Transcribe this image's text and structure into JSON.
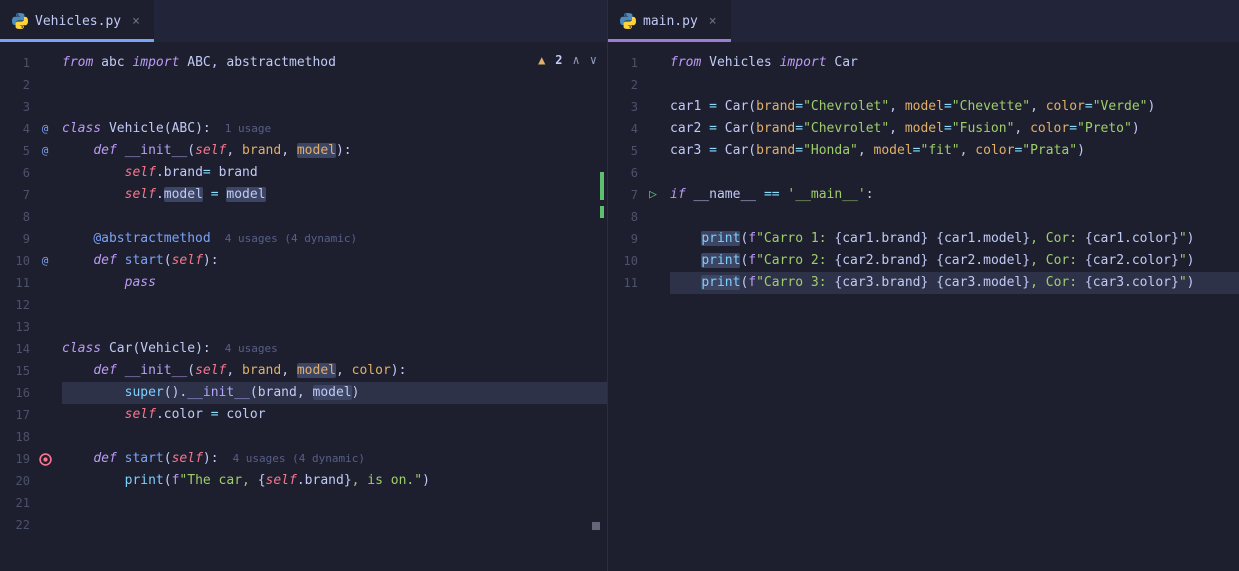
{
  "left": {
    "tab": {
      "label": "Vehicles.py"
    },
    "inspections": {
      "count": "2"
    },
    "lines": {
      "l1": {
        "num": "1"
      },
      "l2": {
        "num": "2"
      },
      "l3": {
        "num": "3"
      },
      "l4": {
        "num": "4",
        "usage": "1 usage"
      },
      "l5": {
        "num": "5"
      },
      "l6": {
        "num": "6"
      },
      "l7": {
        "num": "7"
      },
      "l8": {
        "num": "8"
      },
      "l9": {
        "num": "9",
        "usage": "4 usages (4 dynamic)"
      },
      "l10": {
        "num": "10"
      },
      "l11": {
        "num": "11"
      },
      "l12": {
        "num": "12"
      },
      "l13": {
        "num": "13"
      },
      "l14": {
        "num": "14",
        "usage": "4 usages"
      },
      "l15": {
        "num": "15"
      },
      "l16": {
        "num": "16"
      },
      "l17": {
        "num": "17"
      },
      "l18": {
        "num": "18"
      },
      "l19": {
        "num": "19",
        "usage": "4 usages (4 dynamic)"
      },
      "l20": {
        "num": "20"
      },
      "l21": {
        "num": "21"
      },
      "l22": {
        "num": "22"
      }
    },
    "code": {
      "l1_from": "from",
      "l1_abc": "abc",
      "l1_import": "import",
      "l1_ABC": "ABC",
      "l1_am": "abstractmethod",
      "l4_class": "class",
      "l4_Vehicle": "Vehicle",
      "l4_ABC": "ABC",
      "l5_def": "def",
      "l5_init": "__init__",
      "l5_self": "self",
      "l5_brand": "brand",
      "l5_model": "model",
      "l6_self": "self",
      "l6_brand1": "brand",
      "l6_brand2": "brand",
      "l7_self": "self",
      "l7_model1": "model",
      "l7_model2": "model",
      "l9_dec": "@abstractmethod",
      "l10_def": "def",
      "l10_start": "start",
      "l10_self": "self",
      "l11_pass": "pass",
      "l14_class": "class",
      "l14_Car": "Car",
      "l14_Vehicle": "Vehicle",
      "l15_def": "def",
      "l15_init": "__init__",
      "l15_self": "self",
      "l15_brand": "brand",
      "l15_model": "model",
      "l15_color": "color",
      "l16_super": "super",
      "l16_init": "__init__",
      "l16_brand": "brand",
      "l16_model": "model",
      "l17_self": "self",
      "l17_color1": "color",
      "l17_color2": "color",
      "l19_def": "def",
      "l19_start": "start",
      "l19_self": "self",
      "l20_print": "print",
      "l20_f": "f",
      "l20_s1": "\"The car, ",
      "l20_self": "self",
      "l20_brand": "brand",
      "l20_s2": ", is on.\""
    }
  },
  "right": {
    "tab": {
      "label": "main.py"
    },
    "lines": {
      "l1": {
        "num": "1"
      },
      "l2": {
        "num": "2"
      },
      "l3": {
        "num": "3"
      },
      "l4": {
        "num": "4"
      },
      "l5": {
        "num": "5"
      },
      "l6": {
        "num": "6"
      },
      "l7": {
        "num": "7"
      },
      "l8": {
        "num": "8"
      },
      "l9": {
        "num": "9"
      },
      "l10": {
        "num": "10"
      },
      "l11": {
        "num": "11"
      }
    },
    "code": {
      "l1_from": "from",
      "l1_Vehicles": "Vehicles",
      "l1_import": "import",
      "l1_Car": "Car",
      "l3_car": "car1",
      "l3_Car": "Car",
      "l3_b": "brand",
      "l3_bv": "\"Chevrolet\"",
      "l3_m": "model",
      "l3_mv": "\"Chevette\"",
      "l3_c": "color",
      "l3_cv": "\"Verde\"",
      "l4_car": "car2",
      "l4_Car": "Car",
      "l4_b": "brand",
      "l4_bv": "\"Chevrolet\"",
      "l4_m": "model",
      "l4_mv": "\"Fusion\"",
      "l4_c": "color",
      "l4_cv": "\"Preto\"",
      "l5_car": "car3",
      "l5_Car": "Car",
      "l5_b": "brand",
      "l5_bv": "\"Honda\"",
      "l5_m": "model",
      "l5_mv": "\"fit\"",
      "l5_c": "color",
      "l5_cv": "\"Prata\"",
      "l7_if": "if",
      "l7_name": "__name__",
      "l7_eq": "==",
      "l7_main": "'__main__'",
      "l9_print": "print",
      "l9_f": "f",
      "l9_s1": "\"Carro 1: ",
      "l9_e1": "car1.brand",
      "l9_s2": " ",
      "l9_e2": "car1.model",
      "l9_s3": ", Cor: ",
      "l9_e3": "car1.color",
      "l9_s4": "\"",
      "l10_print": "print",
      "l10_f": "f",
      "l10_s1": "\"Carro 2: ",
      "l10_e1": "car2.brand",
      "l10_s2": " ",
      "l10_e2": "car2.model",
      "l10_s3": ", Cor: ",
      "l10_e3": "car2.color",
      "l10_s4": "\"",
      "l11_print": "print",
      "l11_f": "f",
      "l11_s1": "\"Carro 3: ",
      "l11_e1": "car3.brand",
      "l11_s2": " ",
      "l11_e2": "car3.model",
      "l11_s3": ", Cor: ",
      "l11_e3": "car3.color",
      "l11_s4": "\""
    }
  }
}
